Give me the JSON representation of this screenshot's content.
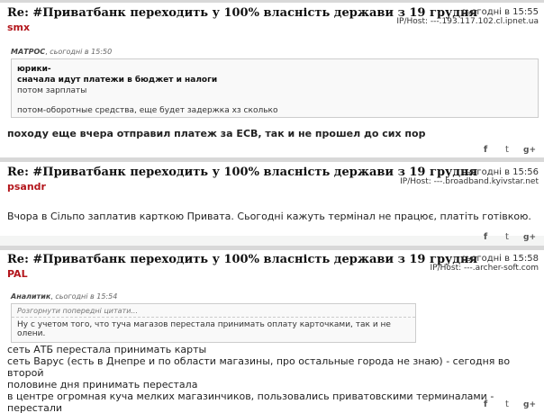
{
  "posts": [
    {
      "title": "Re: #Приватбанк переходить у 100% власність держави з 19 грудня",
      "author": "smx",
      "time": "сьогодні в 15:55",
      "host": "IP/Host: ---.193.117.102.cl.ipnet.ua",
      "quote": {
        "author": "МАТРОС",
        "time": "сьогодні в 15:50",
        "line1": "юрики-",
        "line2": "сначала идут платежи в бюджет и налоги",
        "line3": "потом зарплаты",
        "line4": "потом-оборотные средства, еще будет задержка хз сколько"
      },
      "text": "походу еще вчера отправил платеж за ЕСВ, так и не прошел до сих пор"
    },
    {
      "title": "Re: #Приватбанк переходить у 100% власність держави з 19 грудня",
      "author": "psandr",
      "time": "сьогодні в 15:56",
      "host": "IP/Host: ---.broadband.kyivstar.net",
      "text": "Вчора в Сільпо заплатив карткою Привата. Сьогодні кажуть термінал не працює, платіть готівкою."
    },
    {
      "title": "Re: #Приватбанк переходить у 100% власність держави з 19 грудня",
      "author": "PAL",
      "time": "сьогодні в 15:58",
      "host": "IP/Host: ---.archer-soft.com",
      "quote": {
        "author": "Аналитик",
        "time": "сьогодні в 15:54",
        "expand": "Розгорнути попередні цитати...",
        "body": "Ну с учетом того, что туча магазов перестала принимать оплату карточками, так и не олени."
      },
      "lines": [
        "сеть АТБ перестала принимать карты",
        "сеть Варус (есть в Днепре и по области магазины, про остальные города не знаю) - сегодня во второй",
        "половине дня принимать перестала",
        "в центре огромная куча мелких магазинчиков, пользовались приватовскими терминалами - перестали"
      ]
    }
  ],
  "share": {
    "facebook": "f",
    "twitter": "t",
    "gplus": "g+"
  }
}
